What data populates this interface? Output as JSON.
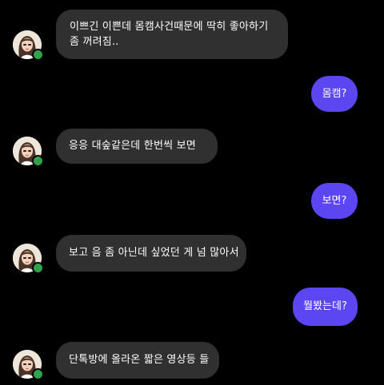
{
  "conversation": {
    "messages": [
      {
        "side": "in",
        "text": "이쁘긴 이쁜데 몸캠사건때문에 딱히 좋아하기 좀 꺼려짐.."
      },
      {
        "side": "out",
        "text": "몸캠?"
      },
      {
        "side": "in",
        "text": "응응 대숲같은데 한번씩 보면"
      },
      {
        "side": "out",
        "text": "보면?"
      },
      {
        "side": "in",
        "text": "보고 음 좀 아닌데 싶었던 게 넘 많아서"
      },
      {
        "side": "out",
        "text": "뭘봤는데?"
      },
      {
        "side": "in",
        "text": "단톡방에 올라온 짧은 영상등 들"
      }
    ]
  },
  "colors": {
    "background": "#000000",
    "incoming_bubble": "#303030",
    "outgoing_bubble": "#5b46f2",
    "online_indicator": "#31a24c"
  },
  "icons": {
    "avatar": "contact-profile-avatar",
    "status": "online-status-dot"
  }
}
